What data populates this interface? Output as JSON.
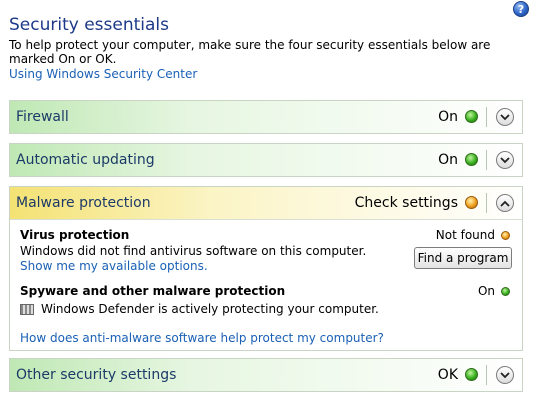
{
  "header": {
    "title": "Security essentials",
    "description": "To help protect your computer, make sure the four security essentials below are marked On or OK.",
    "link": "Using Windows Security Center"
  },
  "firewall": {
    "label": "Firewall",
    "status": "On",
    "status_color": "#39b020"
  },
  "updating": {
    "label": "Automatic updating",
    "status": "On",
    "status_color": "#39b020"
  },
  "malware": {
    "label": "Malware protection",
    "status": "Check settings",
    "status_color": "#f0a020",
    "virus": {
      "title": "Virus protection",
      "description": "Windows did not find antivirus software on this computer.",
      "link": "Show me my available options.",
      "status": "Not found",
      "button": "Find a program"
    },
    "spyware": {
      "title": "Spyware and other malware protection",
      "description": "Windows Defender is actively protecting your computer.",
      "status": "On"
    },
    "help_link": "How does anti-malware software help protect my computer?"
  },
  "other": {
    "label": "Other security settings",
    "status": "OK",
    "status_color": "#39b020"
  },
  "icons": {
    "help": "help-icon",
    "expand": "chevron-down-icon",
    "collapse": "chevron-up-icon",
    "defender": "windows-defender-icon"
  }
}
